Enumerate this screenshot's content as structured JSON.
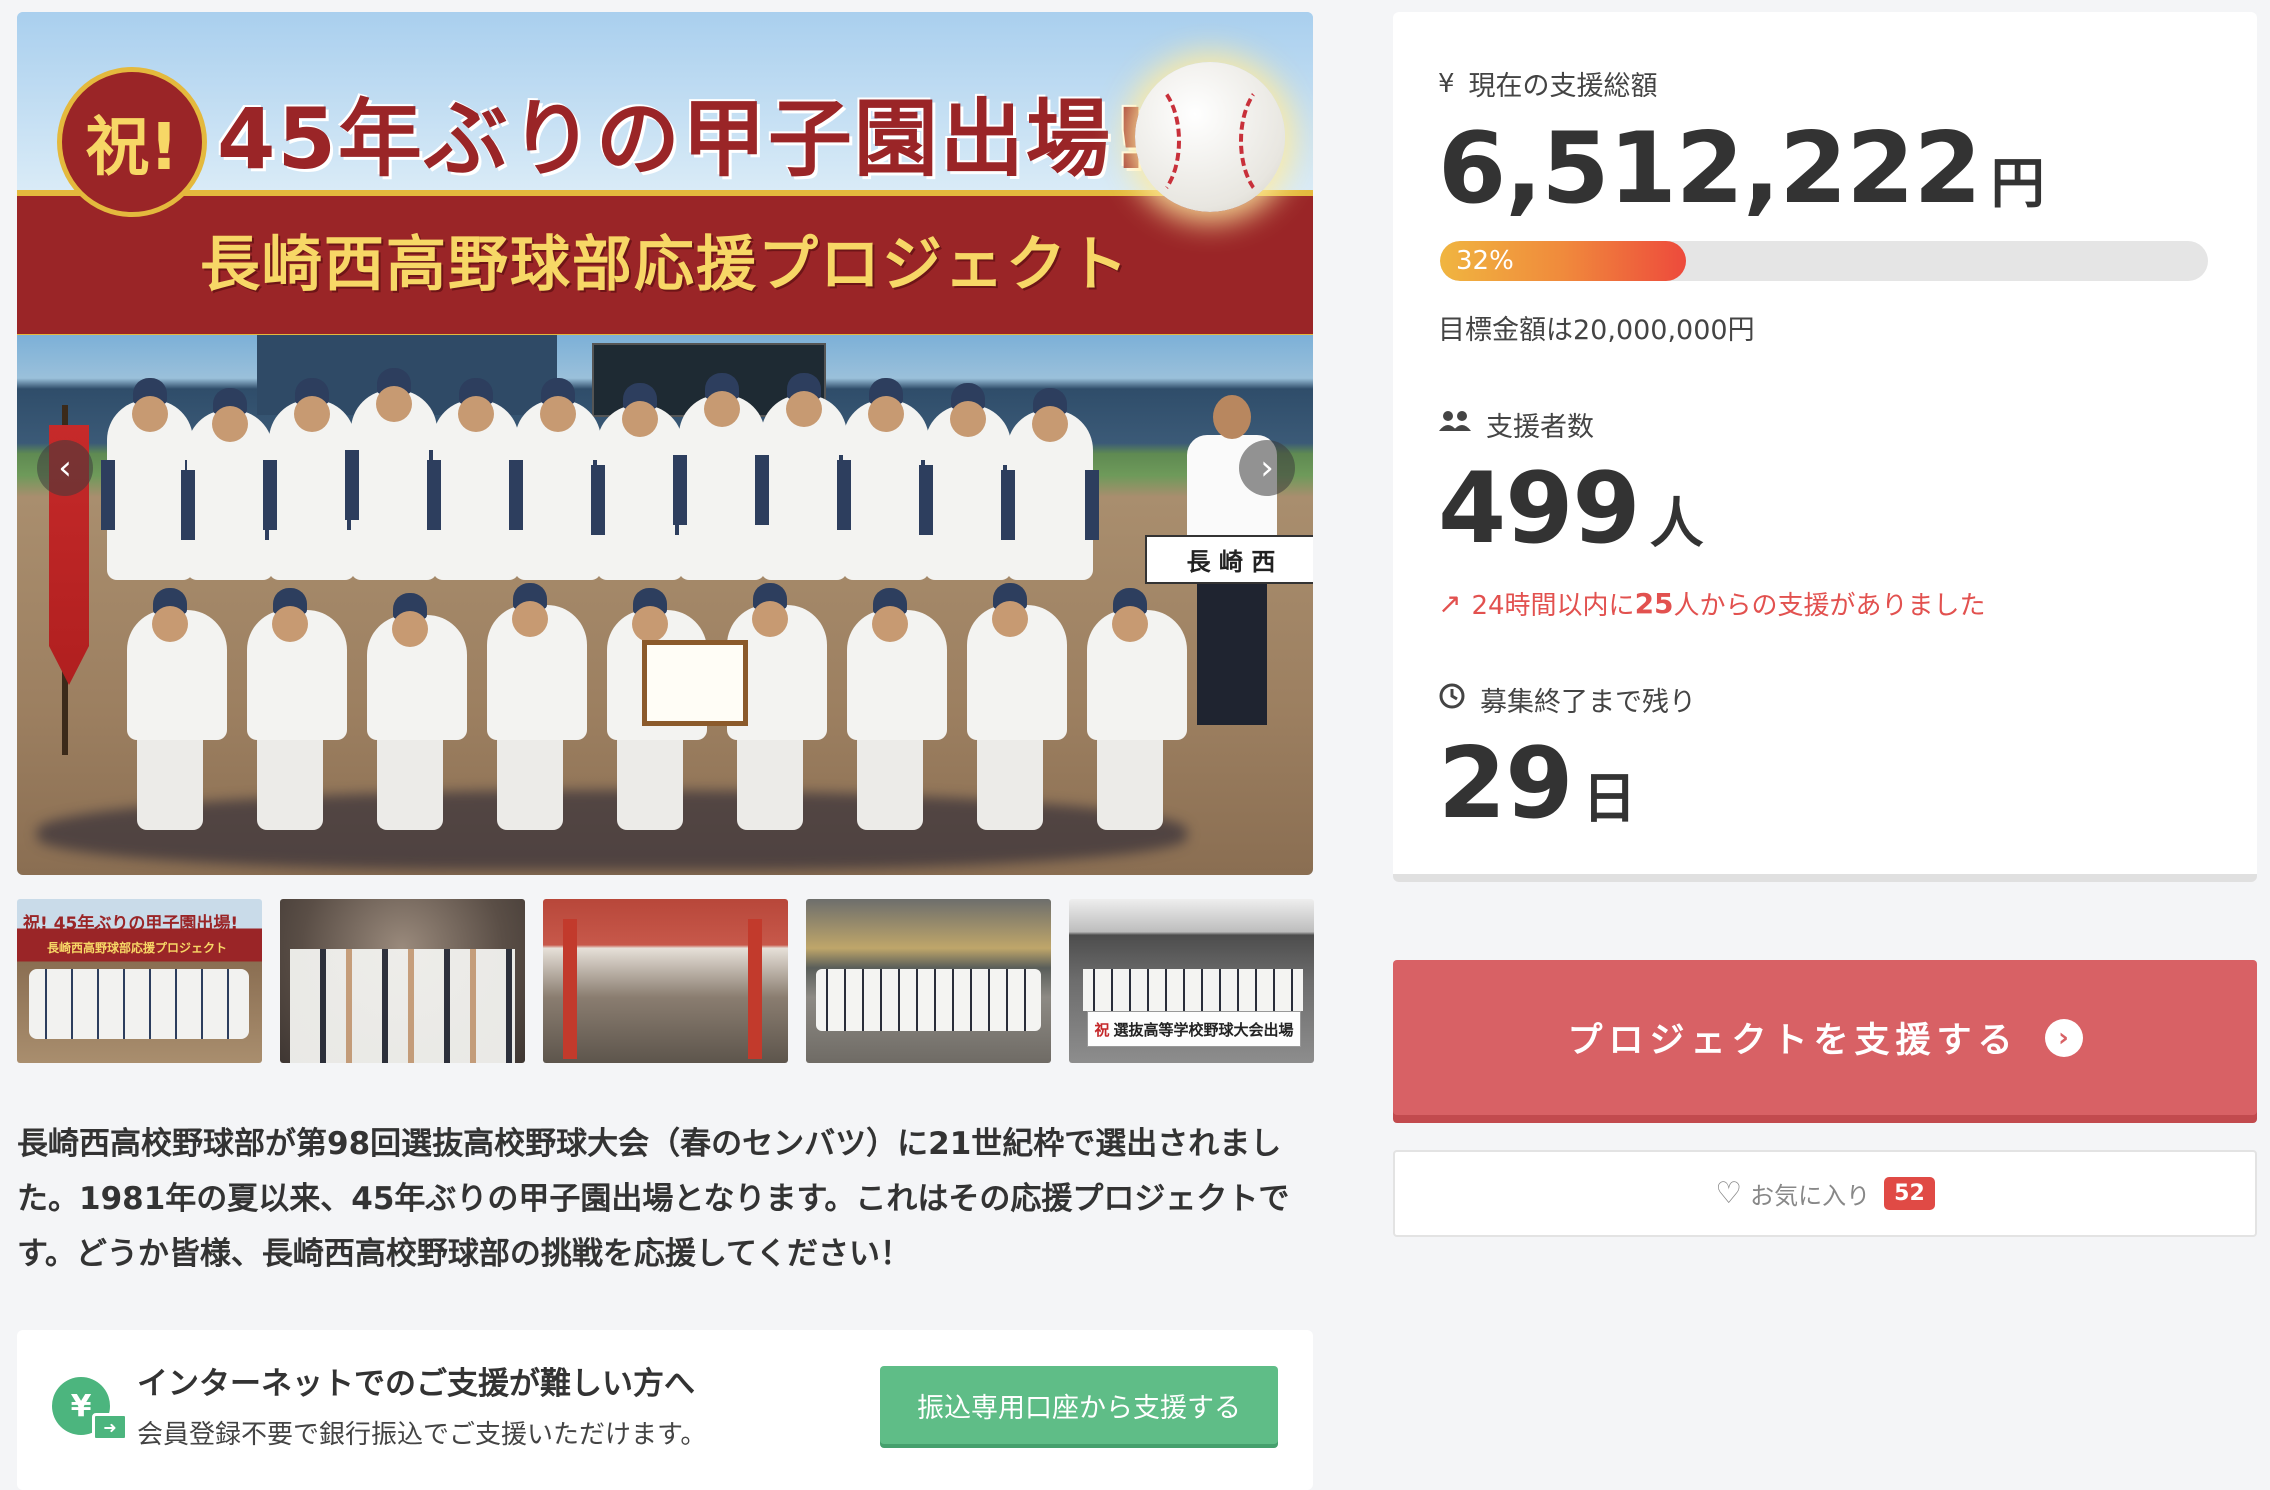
{
  "hero": {
    "banner_circle": "祝!",
    "banner_title": "45年ぶりの甲子園出場!",
    "banner_subtitle": "長崎西高野球部応援プロジェクト",
    "sign_text": "長 崎 西",
    "prev_icon": "chevron-left-icon",
    "next_icon": "chevron-right-icon"
  },
  "thumbnails": [
    {
      "title": "祝! 45年ぶりの甲子園出場!",
      "subtitle": "長崎西高野球部応援プロジェクト"
    },
    {},
    {},
    {},
    {
      "banner": "選抜高等学校野球大会出場",
      "banner_mark": "祝"
    }
  ],
  "description": "長崎西高校野球部が第98回選抜高校野球大会（春のセンバツ）に21世紀枠で選出されました。1981年の夏以来、45年ぶりの甲子園出場となります。これはその応援プロジェクトです。どうか皆様、長崎西高校野球部の挑戦を応援してください！",
  "bank_transfer": {
    "icon": "yen-transfer-icon",
    "title": "インターネットでのご支援が難しい方へ",
    "subtitle": "会員登録不要で銀行振込でご支援いただけます。",
    "button_label": "振込専用口座から支援する"
  },
  "stats": {
    "total_label": "現在の支援総額",
    "total_icon": "yen-icon",
    "total_amount": "6,512,222",
    "total_unit": "円",
    "progress_percent": 32,
    "progress_label": "32%",
    "target_text": "目標金額は20,000,000円",
    "supporters_label": "支援者数",
    "supporters_icon": "users-icon",
    "supporters_count": "499",
    "supporters_unit": "人",
    "trend_prefix": "24時間以内に",
    "trend_count": "25",
    "trend_suffix": "人からの支援がありました",
    "trend_icon": "trending-up-icon",
    "remaining_label": "募集終了まで残り",
    "remaining_icon": "clock-icon",
    "remaining_days": "29",
    "remaining_unit": "日"
  },
  "actions": {
    "support_label": "プロジェクトを支援する",
    "support_icon": "chevron-circle-right-icon",
    "favorite_label": "お気に入り",
    "favorite_icon": "heart-icon",
    "favorite_count": "52"
  },
  "colors": {
    "accent_red": "#d86165",
    "trend_red": "#e2514f",
    "bank_green": "#5fbd87",
    "banner_maroon": "#9a2527",
    "banner_gold": "#f7d766"
  }
}
